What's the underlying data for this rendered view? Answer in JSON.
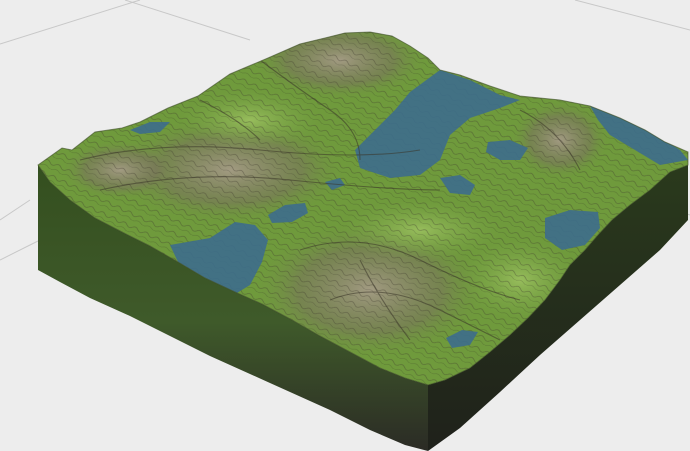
{
  "scene": {
    "description_hidden": "",
    "colors": {
      "background": "#ededed",
      "grid_line": "#c4c4c4",
      "grass": "#6f9a3c",
      "grass_light": "#8fb55a",
      "rock": "#8a7f6a",
      "rock_dark": "#5a5446",
      "water": "#3f6f8f",
      "side_top": "#3c5a24",
      "side_bottom": "#2a2a22"
    }
  }
}
